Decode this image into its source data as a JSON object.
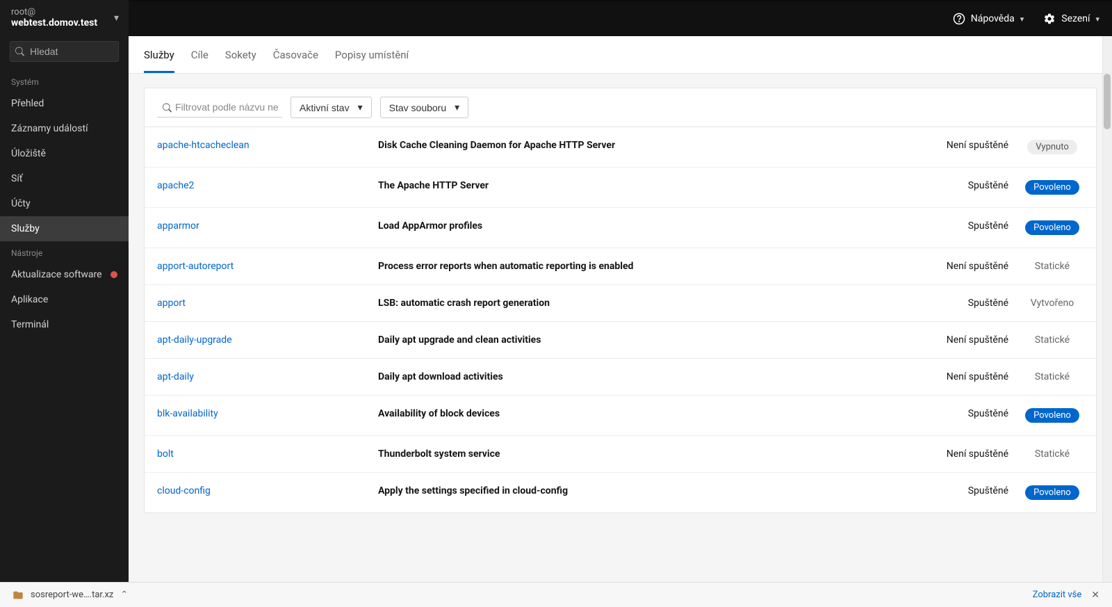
{
  "host": {
    "user": "root@",
    "hostname": "webtest.domov.test"
  },
  "search": {
    "placeholder": "Hledat"
  },
  "nav": {
    "section_system": "Systém",
    "section_tools": "Nástroje",
    "overview": "Přehled",
    "logs": "Záznamy událostí",
    "storage": "Úložiště",
    "network": "Síť",
    "accounts": "Účty",
    "services": "Služby",
    "updates": "Aktualizace software",
    "apps": "Aplikace",
    "terminal": "Terminál"
  },
  "topbar": {
    "help": "Nápověda",
    "session": "Sezení"
  },
  "tabs": {
    "services": "Služby",
    "targets": "Cíle",
    "sockets": "Sokety",
    "timers": "Časovače",
    "paths": "Popisy umístění"
  },
  "filters": {
    "placeholder": "Filtrovat podle názvu ne…",
    "active_state": "Aktivní stav",
    "file_state": "Stav souboru"
  },
  "status_labels": {
    "running": "Spuštěné",
    "not_running": "Není spuštěné"
  },
  "file_labels": {
    "enabled": "Povoleno",
    "disabled": "Vypnuto",
    "static": "Statické",
    "generated": "Vytvořeno"
  },
  "services": [
    {
      "name": "apache-htcacheclean",
      "desc": "Disk Cache Cleaning Daemon for Apache HTTP Server",
      "status": "not_running",
      "file": "disabled"
    },
    {
      "name": "apache2",
      "desc": "The Apache HTTP Server",
      "status": "running",
      "file": "enabled"
    },
    {
      "name": "apparmor",
      "desc": "Load AppArmor profiles",
      "status": "running",
      "file": "enabled"
    },
    {
      "name": "apport-autoreport",
      "desc": "Process error reports when automatic reporting is enabled",
      "status": "not_running",
      "file": "static"
    },
    {
      "name": "apport",
      "desc": "LSB: automatic crash report generation",
      "status": "running",
      "file": "generated"
    },
    {
      "name": "apt-daily-upgrade",
      "desc": "Daily apt upgrade and clean activities",
      "status": "not_running",
      "file": "static"
    },
    {
      "name": "apt-daily",
      "desc": "Daily apt download activities",
      "status": "not_running",
      "file": "static"
    },
    {
      "name": "blk-availability",
      "desc": "Availability of block devices",
      "status": "running",
      "file": "enabled"
    },
    {
      "name": "bolt",
      "desc": "Thunderbolt system service",
      "status": "not_running",
      "file": "static"
    },
    {
      "name": "cloud-config",
      "desc": "Apply the settings specified in cloud-config",
      "status": "running",
      "file": "enabled"
    }
  ],
  "download": {
    "filename": "sosreport-we….tar.xz",
    "show_all": "Zobrazit vše"
  }
}
